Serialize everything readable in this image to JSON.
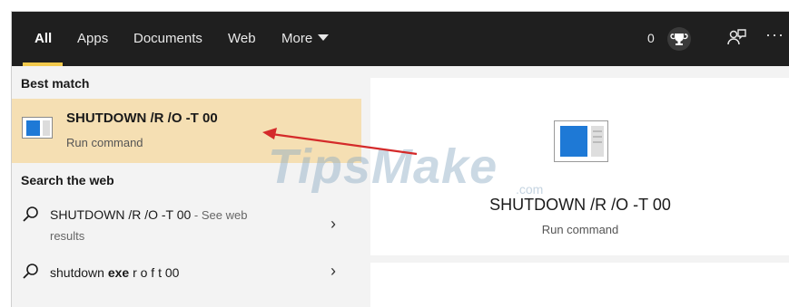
{
  "tabs": [
    {
      "label": "All",
      "active": true
    },
    {
      "label": "Apps"
    },
    {
      "label": "Documents"
    },
    {
      "label": "Web"
    },
    {
      "label": "More"
    }
  ],
  "header": {
    "points": "0",
    "icons": [
      "trophy-icon",
      "feedback-icon",
      "more-options-icon"
    ]
  },
  "left": {
    "best_match_heading": "Best match",
    "best_match": {
      "title": "SHUTDOWN /R /O -T 00",
      "subtitle": "Run command"
    },
    "search_web_heading": "Search the web",
    "web_results": [
      {
        "query": "SHUTDOWN /R /O -T 00",
        "suffix": " - See web",
        "suffix2": "results"
      },
      {
        "query_prefix": "shutdown ",
        "query_bold": "exe",
        "query_rest": " r o f t 00"
      }
    ]
  },
  "preview": {
    "title": "SHUTDOWN /R /O -T 00",
    "subtitle": "Run command"
  },
  "watermark": {
    "text": "TipsMake",
    "suffix": ".com"
  },
  "colors": {
    "topbar": "#1f1f1f",
    "accent": "#f2c94c",
    "highlight": "#f5dfb3",
    "arrow": "#d42a2a"
  }
}
